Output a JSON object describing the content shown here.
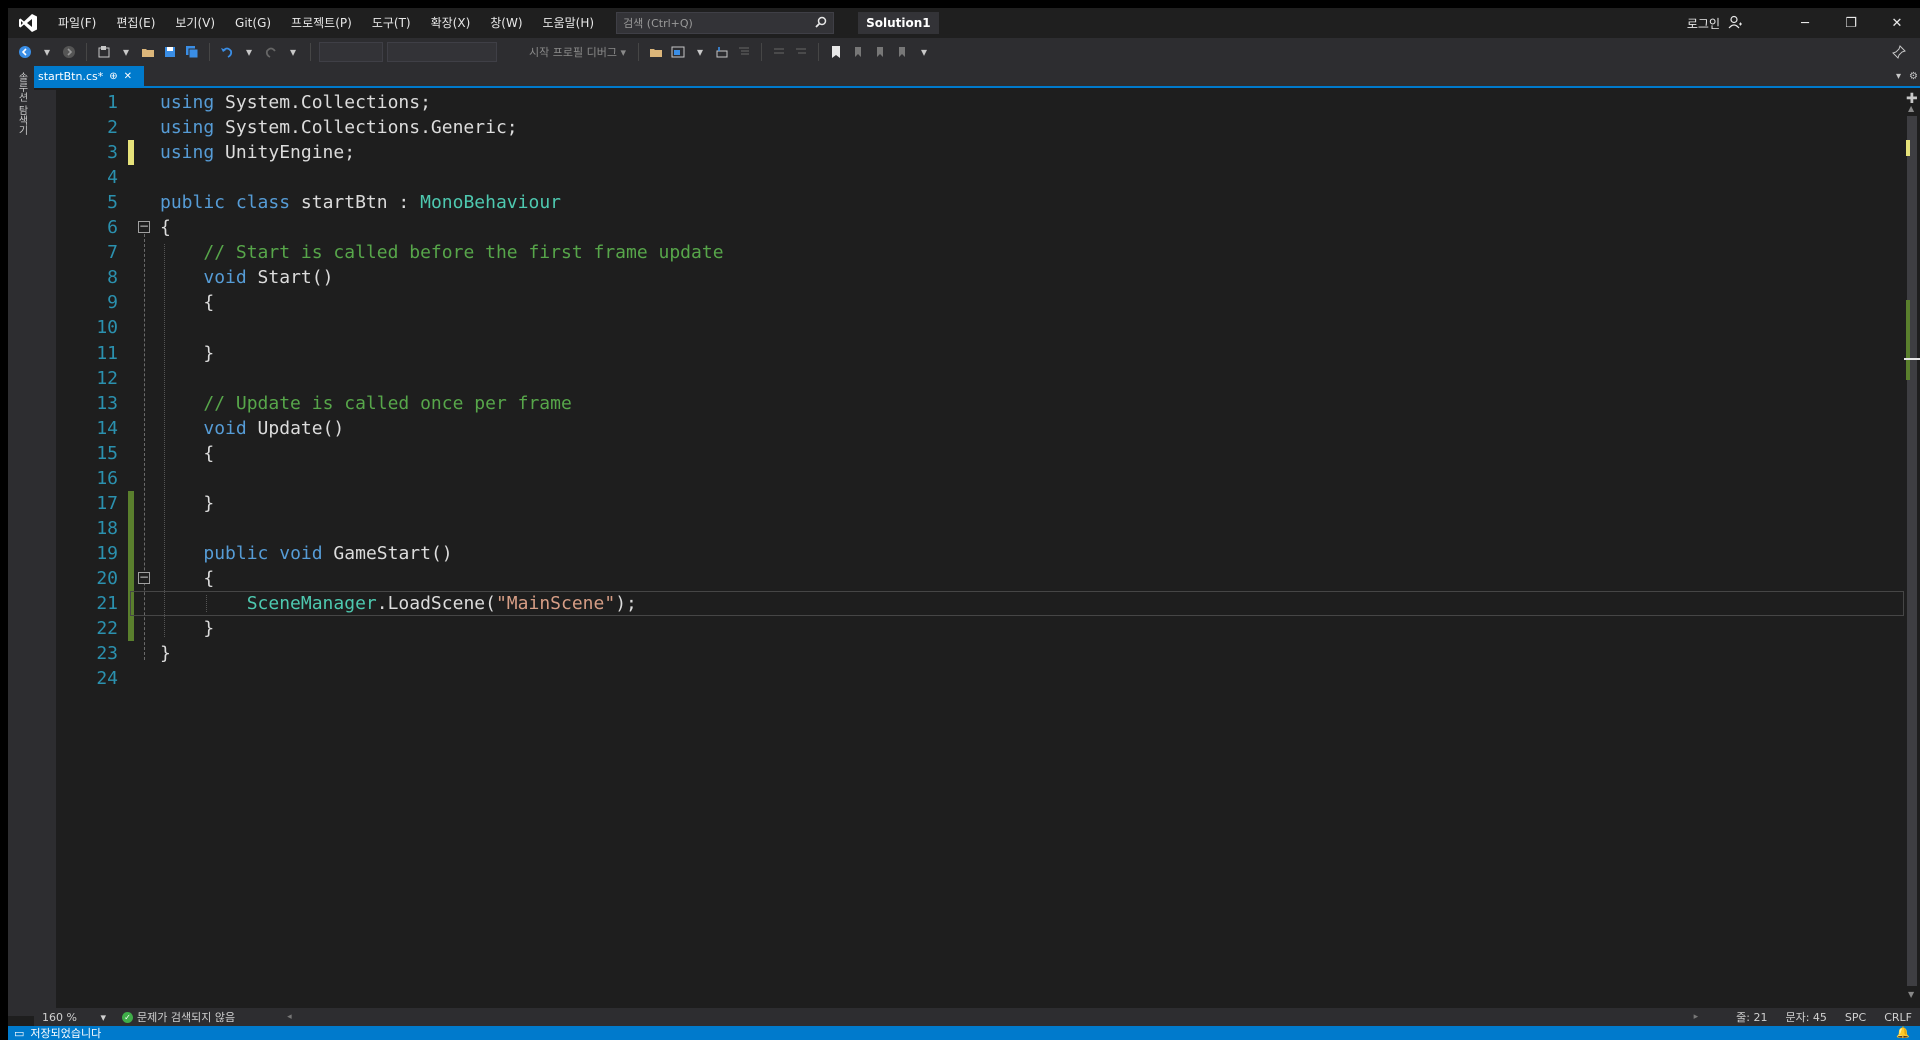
{
  "menu": {
    "items": [
      "파일(F)",
      "편집(E)",
      "보기(V)",
      "Git(G)",
      "프로젝트(P)",
      "도구(T)",
      "확장(X)",
      "창(W)",
      "도움말(H)"
    ],
    "search_placeholder": "검색 (Ctrl+Q)",
    "solution": "Solution1",
    "login": "로그인"
  },
  "toolbar": {
    "start_label": "시작 프로필 디버그 ▾"
  },
  "left_strip": {
    "label": "솔루션 탐색기"
  },
  "tab": {
    "name": "startBtn.cs*"
  },
  "editor": {
    "line_numbers": [
      "1",
      "2",
      "3",
      "4",
      "5",
      "6",
      "7",
      "8",
      "9",
      "10",
      "11",
      "12",
      "13",
      "14",
      "15",
      "16",
      "17",
      "18",
      "19",
      "20",
      "21",
      "22",
      "23",
      "24"
    ],
    "lines": [
      "using System.Collections;",
      "using System.Collections.Generic;",
      "using UnityEngine;",
      "",
      "public class startBtn : MonoBehaviour",
      "{",
      "    // Start is called before the first frame update",
      "    void Start()",
      "    {",
      "",
      "    }",
      "",
      "    // Update is called once per frame",
      "    void Update()",
      "    {",
      "",
      "    }",
      "",
      "    public void GameStart()",
      "    {",
      "        SceneManager.LoadScene(\"MainScene\");",
      "    }",
      "}",
      ""
    ],
    "current_line": 21,
    "colors": {
      "keyword": "#569cd6",
      "type": "#4ec9b0",
      "comment": "#57a64a",
      "string": "#d69d85",
      "line_number": "#2b91af",
      "change_saved": "#5a7f2d",
      "change_unsaved": "#e6e27a"
    }
  },
  "status": {
    "zoom": "160 %",
    "issues": "문제가 검색되지 않음",
    "line": "줄: 21",
    "col": "문자: 45",
    "spc": "SPC",
    "crlf": "CRLF",
    "bottom": "저장되었습니다"
  }
}
